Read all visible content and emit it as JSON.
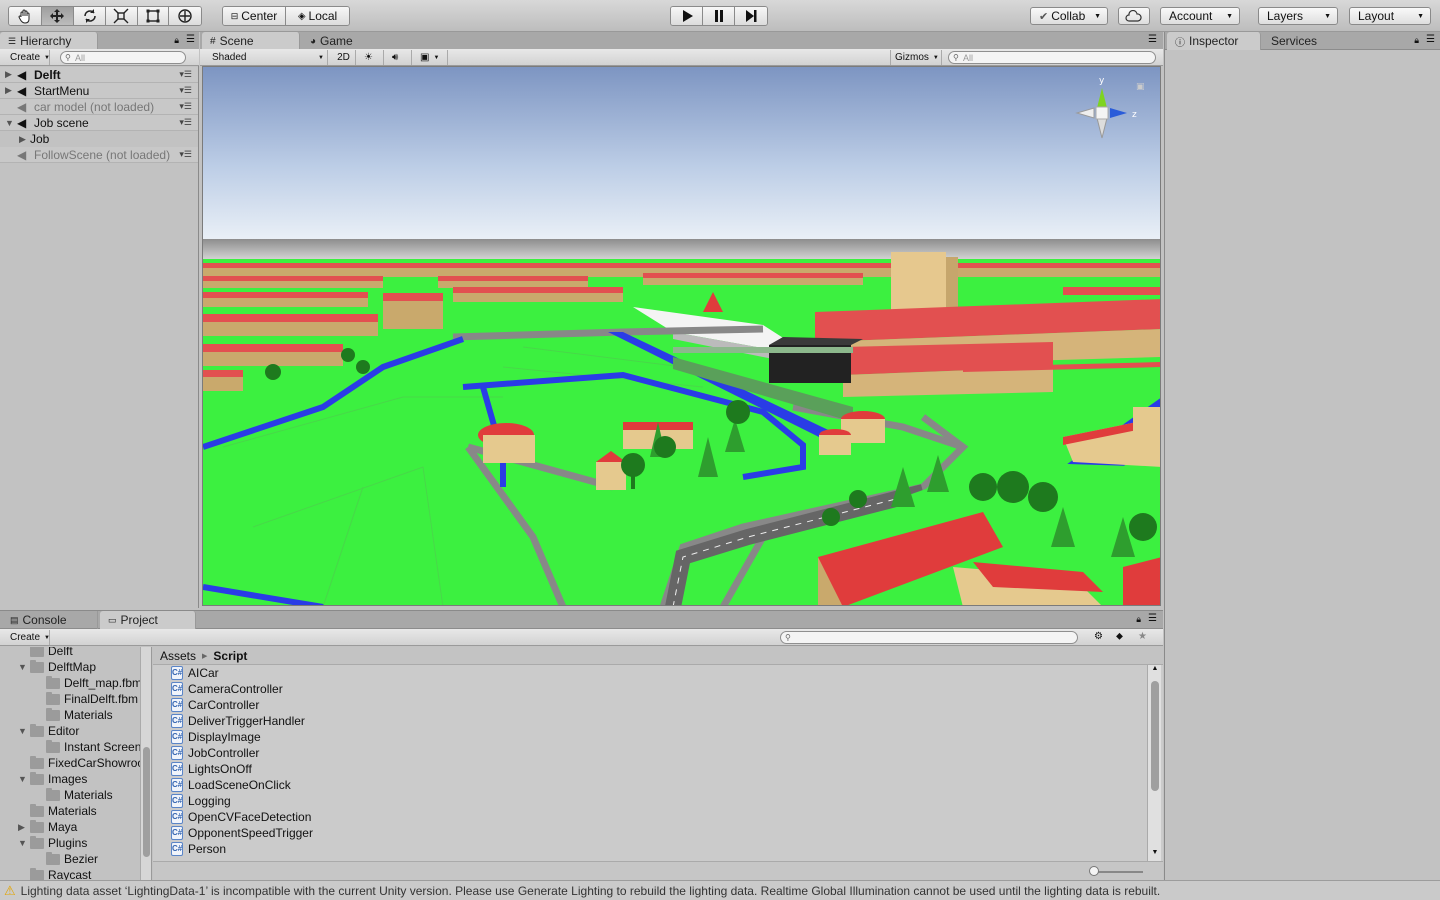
{
  "toolbar": {
    "tools": [
      "hand-icon",
      "move-icon",
      "rotate-icon",
      "scale-icon",
      "rect-icon",
      "transform-icon"
    ],
    "pivot": "Center",
    "space": "Local",
    "collab": "Collab",
    "account": "Account",
    "layers": "Layers",
    "layout": "Layout"
  },
  "hierarchy": {
    "tab": "Hierarchy",
    "create": "Create",
    "search_placeholder": "All",
    "items": [
      {
        "label": "Delft",
        "bold": true,
        "expanded": false
      },
      {
        "label": "StartMenu",
        "bold": false,
        "expanded": false
      },
      {
        "label": "car model (not loaded)",
        "bold": false,
        "unloaded": true
      },
      {
        "label": "Job scene",
        "bold": false,
        "expanded": true
      },
      {
        "label": "Job",
        "child": true
      },
      {
        "label": "FollowScene (not loaded)",
        "bold": false,
        "unloaded": true
      }
    ]
  },
  "scene": {
    "tab_scene": "Scene",
    "tab_game": "Game",
    "shading": "Shaded",
    "mode_2d": "2D",
    "gizmos": "Gizmos",
    "search_placeholder": "All",
    "gizmo_y": "y",
    "gizmo_z": "z"
  },
  "inspector": {
    "tab_inspector": "Inspector",
    "tab_services": "Services"
  },
  "bottom": {
    "tab_console": "Console",
    "tab_project": "Project",
    "create": "Create",
    "breadcrumb_root": "Assets",
    "breadcrumb_current": "Script",
    "tree": [
      {
        "label": "Delft",
        "indent": 1
      },
      {
        "label": "DelftMap",
        "indent": 1,
        "expanded": true
      },
      {
        "label": "Delft_map.fbm",
        "indent": 2
      },
      {
        "label": "FinalDelft.fbm",
        "indent": 2
      },
      {
        "label": "Materials",
        "indent": 2
      },
      {
        "label": "Editor",
        "indent": 1,
        "expanded": true
      },
      {
        "label": "Instant Screen",
        "indent": 2
      },
      {
        "label": "FixedCarShowroo",
        "indent": 1
      },
      {
        "label": "Images",
        "indent": 1,
        "expanded": true
      },
      {
        "label": "Materials",
        "indent": 2
      },
      {
        "label": "Materials",
        "indent": 1
      },
      {
        "label": "Maya",
        "indent": 1,
        "collapsed": true
      },
      {
        "label": "Plugins",
        "indent": 1,
        "expanded": true
      },
      {
        "label": "Bezier",
        "indent": 2
      },
      {
        "label": "Raycast",
        "indent": 1
      }
    ],
    "files": [
      "AICar",
      "CameraController",
      "CarController",
      "DeliverTriggerHandler",
      "DisplayImage",
      "JobController",
      "LightsOnOff",
      "LoadSceneOnClick",
      "Logging",
      "OpenCVFaceDetection",
      "OpponentSpeedTrigger",
      "Person"
    ]
  },
  "status": {
    "message": "Lighting data asset ‘LightingData-1’ is incompatible with the current Unity version. Please use Generate Lighting to rebuild the lighting data.  Realtime Global Illumination cannot be used until the lighting data is rebuilt."
  }
}
